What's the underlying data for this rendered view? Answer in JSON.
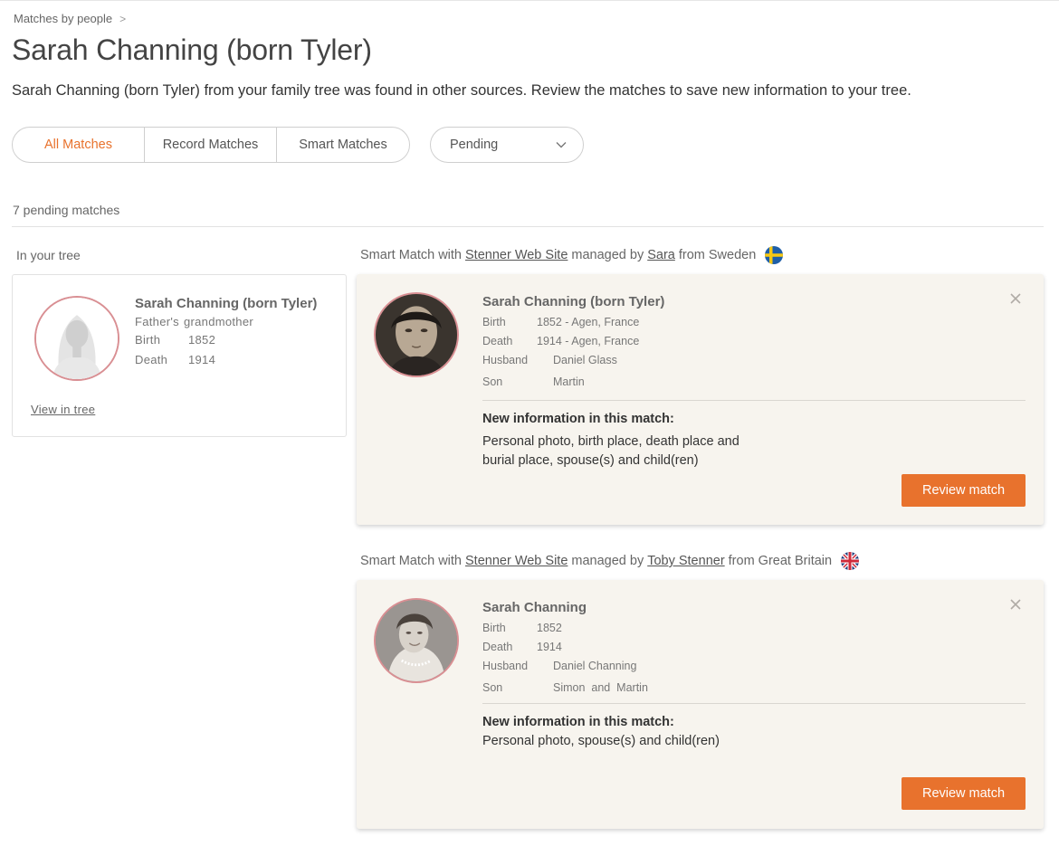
{
  "breadcrumb": {
    "parent": "Matches by people",
    "separator": ">"
  },
  "page": {
    "title": "Sarah Channing (born Tyler)",
    "description": "Sarah Channing (born Tyler) from your family tree was found in other sources. Review the matches to save new information to your tree."
  },
  "filters": {
    "tabs": [
      {
        "label": "All Matches",
        "active": true
      },
      {
        "label": "Record Matches",
        "active": false
      },
      {
        "label": "Smart Matches",
        "active": false
      }
    ],
    "status": {
      "selected": "Pending"
    }
  },
  "count_text": "7 pending matches",
  "tree": {
    "section_label": "In your tree",
    "name": "Sarah Channing (born Tyler)",
    "relation_a": "Father's",
    "relation_b": "grandmother",
    "birth_label": "Birth",
    "birth_value": "1852",
    "death_label": "Death",
    "death_value": "1914",
    "view_link": "View in tree"
  },
  "matches": [
    {
      "source_prefix": "Smart Match with",
      "site": "Stenner Web Site",
      "managed_by": "managed by",
      "manager": "Sara",
      "from": "from Sweden",
      "flag": "sweden-flag",
      "name": "Sarah Channing (born Tyler)",
      "birth_label": "Birth",
      "birth_value": "1852 - Agen, France",
      "death_label": "Death",
      "death_value": "1914 - Agen, France",
      "husband_label": "Husband",
      "husband_value": "Daniel Glass",
      "son_label": "Son",
      "son_value": "Martin",
      "new_info_title": "New information in this match:",
      "new_info_line1": "Personal photo, birth place, death place and",
      "new_info_line2": "burial place, spouse(s) and child(ren)",
      "review_label": "Review match"
    },
    {
      "source_prefix": "Smart Match with",
      "site": "Stenner Web Site",
      "managed_by": "managed by",
      "manager": "Toby Stenner",
      "from": "from Great Britain",
      "flag": "uk-flag",
      "name": "Sarah Channing",
      "birth_label": "Birth",
      "birth_value": "1852",
      "death_label": "Death",
      "death_value": "1914",
      "husband_label": "Husband",
      "husband_value": "Daniel Channing",
      "son_label": "Son",
      "son_value": "Simon  and  Martin",
      "new_info_title": "New information in this match:",
      "new_info_line1": "Personal photo, spouse(s) and child(ren)",
      "review_label": "Review match"
    }
  ],
  "colors": {
    "accent": "#e8722d",
    "card_bg": "#f7f4ee",
    "avatar_ring": "#d98f93"
  }
}
